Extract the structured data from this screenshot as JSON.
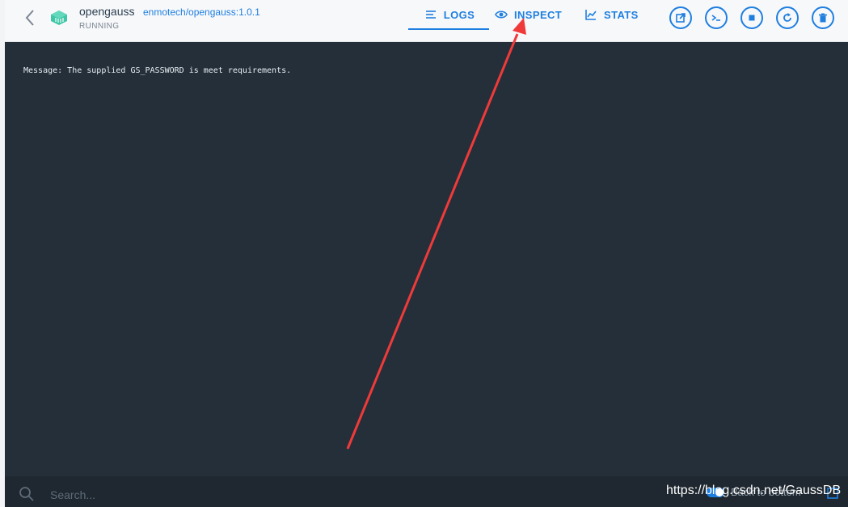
{
  "header": {
    "container_name": "opengauss",
    "image": "enmotech/opengauss:1.0.1",
    "status": "RUNNING",
    "back_icon": "chevron-left-icon",
    "container_icon": "container-icon"
  },
  "tabs": [
    {
      "label": "LOGS",
      "icon": "logs-icon",
      "active": true
    },
    {
      "label": "INSPECT",
      "icon": "eye-icon",
      "active": false
    },
    {
      "label": "STATS",
      "icon": "chart-icon",
      "active": false
    }
  ],
  "actions": [
    {
      "name": "open-browser",
      "icon": "external-link-icon"
    },
    {
      "name": "cli",
      "icon": "terminal-icon"
    },
    {
      "name": "stop",
      "icon": "stop-icon"
    },
    {
      "name": "restart",
      "icon": "restart-icon"
    },
    {
      "name": "delete",
      "icon": "trash-icon"
    }
  ],
  "logs": {
    "lines": [
      "Message: The supplied GS_PASSWORD is meet requirements."
    ]
  },
  "bottom": {
    "search_placeholder": "Search...",
    "back_to_bottom_label": "Back to bottom"
  },
  "watermark": "https://blog.csdn.net/GaussDB",
  "colors": {
    "accent": "#1f7fe0",
    "log_bg": "#252f39",
    "header_bg": "#f7f8fa",
    "container_icon": "#3ec7a6",
    "annotation_arrow": "#f03a3a"
  }
}
